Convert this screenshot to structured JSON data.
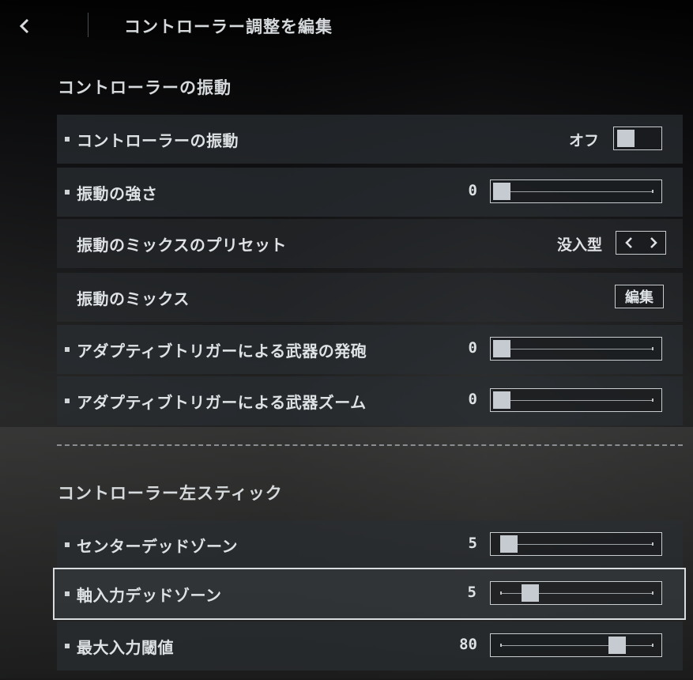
{
  "header": {
    "title": "コントローラー調整を編集"
  },
  "section_vibration": {
    "title": "コントローラーの振動"
  },
  "section_stick": {
    "title": "コントローラー左スティック"
  },
  "rows": {
    "vibration": {
      "label": "コントローラーの振動",
      "toggle_text": "オフ",
      "toggle_on": false
    },
    "strength": {
      "label": "振動の強さ",
      "value": "0",
      "level": 0
    },
    "preset": {
      "label": "振動のミックスのプリセット",
      "value": "没入型"
    },
    "mix": {
      "label": "振動のミックス",
      "button": "編集"
    },
    "trigger_fire": {
      "label": "アダプティブトリガーによる武器の発砲",
      "value": "0",
      "level": 0
    },
    "trigger_zoom": {
      "label": "アダプティブトリガーによる武器ズーム",
      "value": "0",
      "level": 0
    },
    "center_deadzone": {
      "label": "センターデッドゾーン",
      "value": "5",
      "level": 0.05
    },
    "axial_deadzone": {
      "label": "軸入力デッドゾーン",
      "value": "5",
      "level": 0.2
    },
    "max_threshold": {
      "label": "最大入力閾値",
      "value": "80",
      "level": 0.82
    }
  },
  "colors": {
    "accent": "#c5cbd0",
    "selected_outline": "#d8dcde"
  }
}
